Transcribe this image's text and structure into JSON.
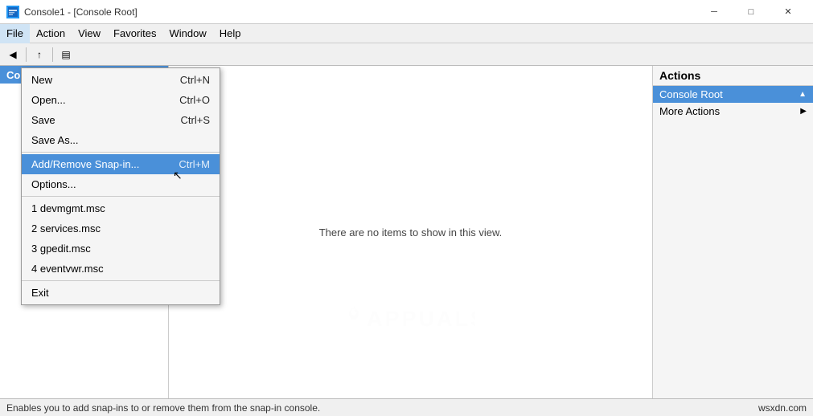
{
  "titlebar": {
    "icon_label": "console-icon",
    "title": "Console1 - [Console Root]",
    "min_btn": "─",
    "max_btn": "□",
    "close_btn": "✕"
  },
  "menubar": {
    "items": [
      {
        "label": "File",
        "id": "file",
        "active": true
      },
      {
        "label": "Action",
        "id": "action"
      },
      {
        "label": "View",
        "id": "view"
      },
      {
        "label": "Favorites",
        "id": "favorites"
      },
      {
        "label": "Window",
        "id": "window"
      },
      {
        "label": "Help",
        "id": "help"
      }
    ]
  },
  "dropdown": {
    "items": [
      {
        "label": "New",
        "shortcut": "Ctrl+N",
        "id": "new",
        "selected": false
      },
      {
        "label": "Open...",
        "shortcut": "Ctrl+O",
        "id": "open",
        "selected": false
      },
      {
        "label": "Save",
        "shortcut": "Ctrl+S",
        "id": "save",
        "selected": false
      },
      {
        "label": "Save As...",
        "shortcut": "",
        "id": "saveas",
        "selected": false
      },
      {
        "label": "separator1",
        "type": "sep"
      },
      {
        "label": "Add/Remove Snap-in...",
        "shortcut": "Ctrl+M",
        "id": "addsnapin",
        "selected": true
      },
      {
        "label": "Options...",
        "shortcut": "",
        "id": "options",
        "selected": false
      },
      {
        "label": "separator2",
        "type": "sep"
      },
      {
        "label": "1 devmgmt.msc",
        "shortcut": "",
        "id": "recent1",
        "selected": false
      },
      {
        "label": "2 services.msc",
        "shortcut": "",
        "id": "recent2",
        "selected": false
      },
      {
        "label": "3 gpedit.msc",
        "shortcut": "",
        "id": "recent3",
        "selected": false
      },
      {
        "label": "4 eventvwr.msc",
        "shortcut": "",
        "id": "recent4",
        "selected": false
      },
      {
        "label": "separator3",
        "type": "sep"
      },
      {
        "label": "Exit",
        "shortcut": "",
        "id": "exit",
        "selected": false
      }
    ]
  },
  "left_panel": {
    "header": "Console Root"
  },
  "content": {
    "no_items": "There are no items to show in this view.",
    "watermark": "APPUALS"
  },
  "actions": {
    "header": "Actions",
    "items": [
      {
        "label": "Console Root",
        "id": "console-root",
        "highlighted": true,
        "has_arrow": true
      },
      {
        "label": "More Actions",
        "id": "more-actions",
        "highlighted": false,
        "has_arrow": true
      }
    ]
  },
  "statusbar": {
    "text": "Enables you to add snap-ins to or remove them from the snap-in console.",
    "site": "wsxdn.com"
  }
}
